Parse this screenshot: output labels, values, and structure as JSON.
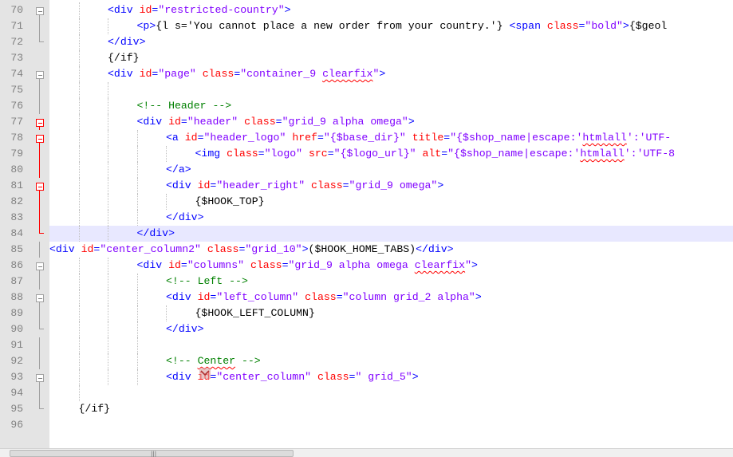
{
  "editor": {
    "language": "smarty-html",
    "current_line": "84",
    "lines": [
      {
        "num": "70",
        "indent": 2,
        "fold": "box",
        "segments": [
          {
            "c": "t-tag",
            "t": "<div "
          },
          {
            "c": "t-attr",
            "t": "id"
          },
          {
            "c": "t-tag",
            "t": "="
          },
          {
            "c": "t-val",
            "t": "\"restricted-country\""
          },
          {
            "c": "t-tag",
            "t": ">"
          }
        ]
      },
      {
        "num": "71",
        "indent": 3,
        "fold": "line",
        "segments": [
          {
            "c": "t-tag",
            "t": "<p>"
          },
          {
            "c": "t-text",
            "t": "{l s='You cannot place a new order from your country.'} "
          },
          {
            "c": "t-tag",
            "t": "<span "
          },
          {
            "c": "t-attr",
            "t": "class"
          },
          {
            "c": "t-tag",
            "t": "="
          },
          {
            "c": "t-val",
            "t": "\"bold\""
          },
          {
            "c": "t-tag",
            "t": ">"
          },
          {
            "c": "t-text",
            "t": "{$geol"
          }
        ]
      },
      {
        "num": "72",
        "indent": 2,
        "fold": "end",
        "segments": [
          {
            "c": "t-tag",
            "t": "</div>"
          }
        ]
      },
      {
        "num": "73",
        "indent": 2,
        "fold": "none",
        "segments": [
          {
            "c": "t-smarty",
            "t": "{/if}"
          }
        ]
      },
      {
        "num": "74",
        "indent": 2,
        "fold": "box",
        "segments": [
          {
            "c": "t-tag",
            "t": "<div "
          },
          {
            "c": "t-attr",
            "t": "id"
          },
          {
            "c": "t-tag",
            "t": "="
          },
          {
            "c": "t-val",
            "t": "\"page\""
          },
          {
            "c": "t-tag",
            "t": " "
          },
          {
            "c": "t-attr",
            "t": "class"
          },
          {
            "c": "t-tag",
            "t": "="
          },
          {
            "c": "t-val",
            "t": "\"container_9 "
          },
          {
            "c": "t-val squiggle",
            "t": "clearfix"
          },
          {
            "c": "t-val",
            "t": "\""
          },
          {
            "c": "t-tag",
            "t": ">"
          }
        ]
      },
      {
        "num": "75",
        "indent": 3,
        "fold": "line",
        "segments": []
      },
      {
        "num": "76",
        "indent": 3,
        "fold": "line",
        "segments": [
          {
            "c": "t-comment",
            "t": "<!-- Header -->"
          }
        ]
      },
      {
        "num": "77",
        "indent": 3,
        "fold": "boxred",
        "segments": [
          {
            "c": "t-tag",
            "t": "<div "
          },
          {
            "c": "t-attr",
            "t": "id"
          },
          {
            "c": "t-tag",
            "t": "="
          },
          {
            "c": "t-val",
            "t": "\"header\""
          },
          {
            "c": "t-tag",
            "t": " "
          },
          {
            "c": "t-attr",
            "t": "class"
          },
          {
            "c": "t-tag",
            "t": "="
          },
          {
            "c": "t-val",
            "t": "\"grid_9 alpha omega\""
          },
          {
            "c": "t-tag",
            "t": ">"
          }
        ]
      },
      {
        "num": "78",
        "indent": 4,
        "fold": "boxred",
        "segments": [
          {
            "c": "t-tag",
            "t": "<a "
          },
          {
            "c": "t-attr",
            "t": "id"
          },
          {
            "c": "t-tag",
            "t": "="
          },
          {
            "c": "t-val",
            "t": "\"header_logo\""
          },
          {
            "c": "t-tag",
            "t": " "
          },
          {
            "c": "t-attr",
            "t": "href"
          },
          {
            "c": "t-tag",
            "t": "="
          },
          {
            "c": "t-val",
            "t": "\"{$base_dir}\""
          },
          {
            "c": "t-tag",
            "t": " "
          },
          {
            "c": "t-attr",
            "t": "title"
          },
          {
            "c": "t-tag",
            "t": "="
          },
          {
            "c": "t-val",
            "t": "\"{$shop_name|escape:'"
          },
          {
            "c": "t-val squiggle",
            "t": "htmlall"
          },
          {
            "c": "t-val",
            "t": "':'UTF-"
          }
        ]
      },
      {
        "num": "79",
        "indent": 5,
        "fold": "linered",
        "segments": [
          {
            "c": "t-tag",
            "t": "<img "
          },
          {
            "c": "t-attr",
            "t": "class"
          },
          {
            "c": "t-tag",
            "t": "="
          },
          {
            "c": "t-val",
            "t": "\"logo\""
          },
          {
            "c": "t-tag",
            "t": " "
          },
          {
            "c": "t-attr",
            "t": "src"
          },
          {
            "c": "t-tag",
            "t": "="
          },
          {
            "c": "t-val",
            "t": "\"{$logo_url}\""
          },
          {
            "c": "t-tag",
            "t": " "
          },
          {
            "c": "t-attr",
            "t": "alt"
          },
          {
            "c": "t-tag",
            "t": "="
          },
          {
            "c": "t-val",
            "t": "\"{$shop_name|escape:'"
          },
          {
            "c": "t-val squiggle",
            "t": "htmlall"
          },
          {
            "c": "t-val",
            "t": "':'UTF-8"
          }
        ]
      },
      {
        "num": "80",
        "indent": 4,
        "fold": "linered",
        "segments": [
          {
            "c": "t-tag",
            "t": "</a>"
          }
        ]
      },
      {
        "num": "81",
        "indent": 4,
        "fold": "boxred",
        "segments": [
          {
            "c": "t-tag",
            "t": "<div "
          },
          {
            "c": "t-attr",
            "t": "id"
          },
          {
            "c": "t-tag",
            "t": "="
          },
          {
            "c": "t-val",
            "t": "\"header_right\""
          },
          {
            "c": "t-tag",
            "t": " "
          },
          {
            "c": "t-attr",
            "t": "class"
          },
          {
            "c": "t-tag",
            "t": "="
          },
          {
            "c": "t-val",
            "t": "\"grid_9 omega\""
          },
          {
            "c": "t-tag",
            "t": ">"
          }
        ]
      },
      {
        "num": "82",
        "indent": 5,
        "fold": "linered",
        "segments": [
          {
            "c": "t-smarty",
            "t": "{$HOOK_TOP}"
          }
        ]
      },
      {
        "num": "83",
        "indent": 4,
        "fold": "linered",
        "segments": [
          {
            "c": "t-tag",
            "t": "</div>"
          }
        ]
      },
      {
        "num": "84",
        "indent": 3,
        "fold": "endred",
        "segments": [
          {
            "c": "t-tag",
            "t": "</div>"
          }
        ]
      },
      {
        "num": "85",
        "indent": 0,
        "fold": "line",
        "segments": [
          {
            "c": "t-tag",
            "t": "<div "
          },
          {
            "c": "t-attr",
            "t": "id"
          },
          {
            "c": "t-tag",
            "t": "="
          },
          {
            "c": "t-val",
            "t": "\"center_column2\""
          },
          {
            "c": "t-tag",
            "t": " "
          },
          {
            "c": "t-attr",
            "t": "class"
          },
          {
            "c": "t-tag",
            "t": "="
          },
          {
            "c": "t-val",
            "t": "\"grid_10\""
          },
          {
            "c": "t-tag",
            "t": ">"
          },
          {
            "c": "t-text",
            "t": "($HOOK_HOME_TABS)"
          },
          {
            "c": "t-tag",
            "t": "</div>"
          }
        ]
      },
      {
        "num": "86",
        "indent": 3,
        "fold": "box",
        "segments": [
          {
            "c": "t-tag",
            "t": "<div "
          },
          {
            "c": "t-attr",
            "t": "id"
          },
          {
            "c": "t-tag",
            "t": "="
          },
          {
            "c": "t-val",
            "t": "\"columns\""
          },
          {
            "c": "t-tag",
            "t": " "
          },
          {
            "c": "t-attr",
            "t": "class"
          },
          {
            "c": "t-tag",
            "t": "="
          },
          {
            "c": "t-val",
            "t": "\"grid_9 alpha omega "
          },
          {
            "c": "t-val squiggle",
            "t": "clearfix"
          },
          {
            "c": "t-val",
            "t": "\""
          },
          {
            "c": "t-tag",
            "t": ">"
          }
        ]
      },
      {
        "num": "87",
        "indent": 4,
        "fold": "line",
        "segments": [
          {
            "c": "t-comment",
            "t": "<!-- Left -->"
          }
        ]
      },
      {
        "num": "88",
        "indent": 4,
        "fold": "box",
        "segments": [
          {
            "c": "t-tag",
            "t": "<div "
          },
          {
            "c": "t-attr",
            "t": "id"
          },
          {
            "c": "t-tag",
            "t": "="
          },
          {
            "c": "t-val",
            "t": "\"left_column\""
          },
          {
            "c": "t-tag",
            "t": " "
          },
          {
            "c": "t-attr",
            "t": "class"
          },
          {
            "c": "t-tag",
            "t": "="
          },
          {
            "c": "t-val",
            "t": "\"column grid_2 alpha\""
          },
          {
            "c": "t-tag",
            "t": ">"
          }
        ]
      },
      {
        "num": "89",
        "indent": 5,
        "fold": "line",
        "segments": [
          {
            "c": "t-smarty",
            "t": "{$HOOK_LEFT_COLUMN}"
          }
        ]
      },
      {
        "num": "90",
        "indent": 4,
        "fold": "end",
        "segments": [
          {
            "c": "t-tag",
            "t": "</div>"
          }
        ]
      },
      {
        "num": "91",
        "indent": 4,
        "fold": "line",
        "segments": []
      },
      {
        "num": "92",
        "indent": 4,
        "fold": "line",
        "segments": [
          {
            "c": "t-comment",
            "t": "<!-- "
          },
          {
            "c": "t-comment squiggle",
            "t": "Center"
          },
          {
            "c": "t-comment",
            "t": " -->"
          }
        ]
      },
      {
        "num": "93",
        "indent": 4,
        "fold": "box",
        "segments": [
          {
            "c": "t-tag",
            "t": "<div "
          },
          {
            "c": "t-attr",
            "t": "id"
          },
          {
            "c": "t-tag",
            "t": "="
          },
          {
            "c": "t-val",
            "t": "\"center_column\""
          },
          {
            "c": "t-tag",
            "t": " "
          },
          {
            "c": "t-attr",
            "t": "class"
          },
          {
            "c": "t-tag",
            "t": "="
          },
          {
            "c": "t-val",
            "t": "\" grid_5\""
          },
          {
            "c": "t-tag",
            "t": ">"
          }
        ]
      },
      {
        "num": "94",
        "indent": 2,
        "fold": "line",
        "segments": []
      },
      {
        "num": "95",
        "indent": 1,
        "fold": "end",
        "segments": [
          {
            "c": "t-smarty",
            "t": "{/if}"
          }
        ]
      },
      {
        "num": "96",
        "indent": 0,
        "fold": "none",
        "segments": []
      }
    ]
  },
  "scrollbar": {
    "grip_label": "|||"
  },
  "cursor": {
    "icon": "mouse-cursor-icon"
  }
}
